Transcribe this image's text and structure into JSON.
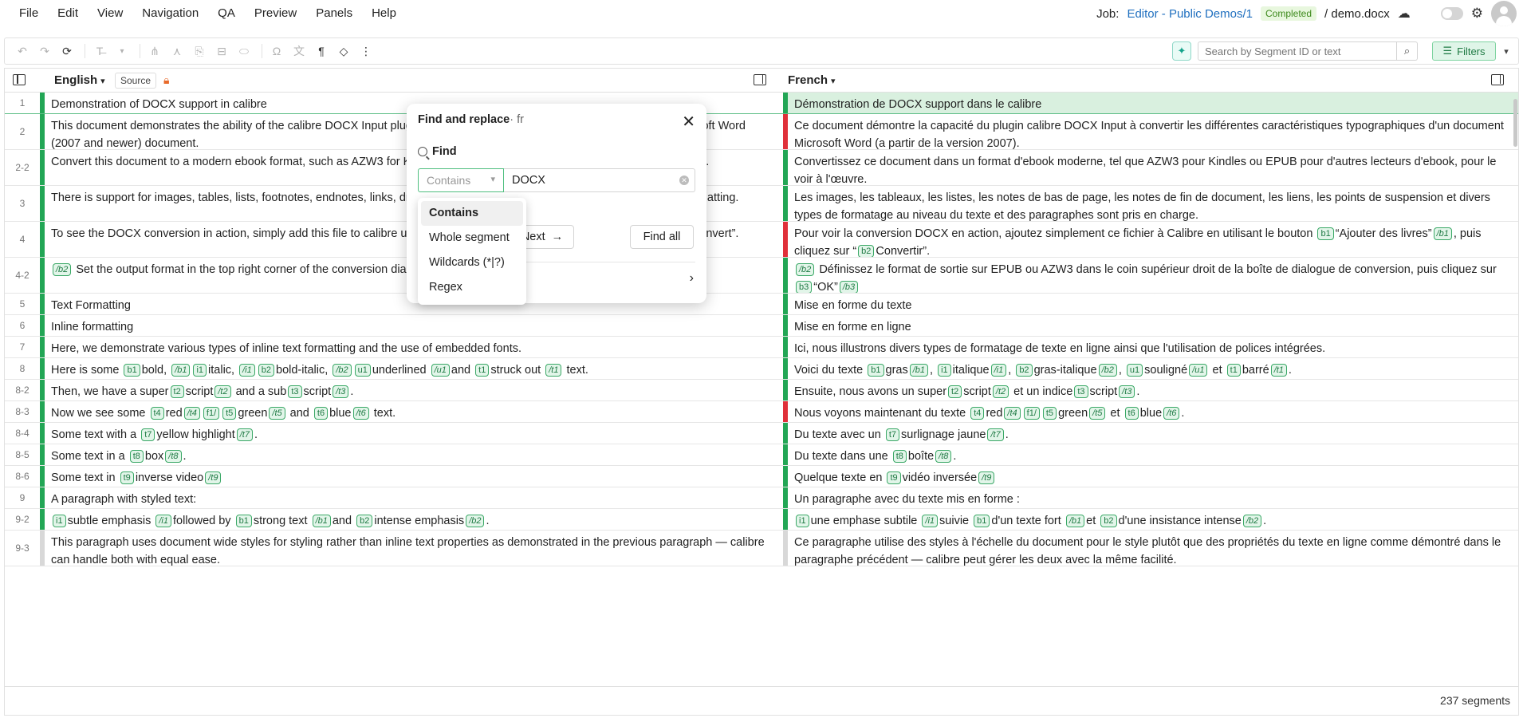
{
  "menu": [
    "File",
    "Edit",
    "View",
    "Navigation",
    "QA",
    "Preview",
    "Panels",
    "Help"
  ],
  "job": {
    "label": "Job:",
    "link": "Editor - Public Demos/1",
    "status": "Completed",
    "file": "/ demo.docx"
  },
  "search": {
    "placeholder": "Search by Segment ID or text"
  },
  "filters_label": "Filters",
  "grid": {
    "source_lang": "English",
    "source_chip": "Source",
    "target_lang": "French"
  },
  "colors": {
    "confirmed": "#22a655",
    "unconfirmed": "#e0303a",
    "none": "#d8d8d8"
  },
  "segments": [
    {
      "id": "1",
      "status": "confirmed",
      "active": true,
      "src": "Demonstration of DOCX support in calibre",
      "tgt": "Démonstration de DOCX support dans le calibre"
    },
    {
      "id": "2",
      "status": "unconfirmed",
      "src": "This document demonstrates the ability of the calibre DOCX Input plugin to convert the various typographic features in a Microsoft Word (2007 and newer) document.",
      "tgt": "Ce document démontre la capacité du plugin calibre DOCX Input à convertir les différentes caractéristiques typographiques d'un document Microsoft Word (a partir de la version 2007)."
    },
    {
      "id": "2-2",
      "status": "confirmed",
      "src": "Convert this document to a modern ebook format, such as AZW3 for Kindles or EPUB for other ebook readers, to see it in action.",
      "tgt": "Convertissez ce document dans un format d'ebook moderne, tel que AZW3 pour Kindles ou EPUB pour d'autres lecteurs d'ebook, pour le voir à l'œuvre."
    },
    {
      "id": "3",
      "status": "confirmed",
      "src": "There is support for images, tables, lists, footnotes, endnotes, links, dropcaps and various types of text and paragraph level formatting.",
      "tgt": "Les images, les tableaux, les listes, les notes de bas de page, les notes de fin de document, les liens, les points de suspension et divers types de formatage au niveau du texte et des paragraphes sont pris en charge."
    },
    {
      "id": "4",
      "status": "unconfirmed",
      "src_html": "To see the DOCX conversion in action, simply add this file to calibre using the <b1>“Add Books”</b1> button and then click “<b2>Convert”.",
      "tgt_html": "Pour voir la conversion DOCX en action, ajoutez simplement ce fichier à Calibre en utilisant le bouton [b1]“Ajouter des livres”[/b1], puis cliquez sur “[b2]Convertir”."
    },
    {
      "id": "4-2",
      "status": "confirmed",
      "src_html": "[/b2] Set the output format in the top right corner of the conversion dialog to EPUB or AZW3 and click [b3]“OK”[/b3]",
      "tgt_html": "[/b2] Définissez le format de sortie sur EPUB ou AZW3 dans le coin supérieur droit de la boîte de dialogue de conversion, puis cliquez sur [b3]“OK”[/b3]"
    },
    {
      "id": "5",
      "status": "confirmed",
      "src": "Text Formatting",
      "tgt": "Mise en forme du texte"
    },
    {
      "id": "6",
      "status": "confirmed",
      "src": "Inline formatting",
      "tgt": "Mise en forme en ligne"
    },
    {
      "id": "7",
      "status": "confirmed",
      "src": "Here, we demonstrate various types of inline text formatting and the use of embedded fonts.",
      "tgt": "Ici, nous illustrons divers types de formatage de texte en ligne ainsi que l'utilisation de polices intégrées."
    },
    {
      "id": "8",
      "status": "confirmed",
      "src_html": "Here is some [b1]bold, [/b1][i1]italic, [/i1][b2]bold-italic, [/b2][u1]underlined [/u1]and [t1]struck out [/t1] text.",
      "tgt_html": "Voici du texte [b1]gras[/b1], [i1]italique[/i1], [b2]gras-italique[/b2], [u1]souligné[/u1] et [t1]barré[/t1]."
    },
    {
      "id": "8-2",
      "status": "confirmed",
      "src_html": "Then, we have a super[t2]script[/t2] and a sub[t3]script[/t3].",
      "tgt_html": "Ensuite, nous avons un super[t2]script[/t2] et un indice[t3]script[/t3]."
    },
    {
      "id": "8-3",
      "status": "unconfirmed",
      "src_html": "Now we see some [t4]red[/t4][f1/][t5]green[/t5] and [t6]blue[/t6] text.",
      "tgt_html": "Nous voyons maintenant du texte [t4]red[/t4][f1/][t5]green[/t5] et [t6]blue[/t6]."
    },
    {
      "id": "8-4",
      "status": "confirmed",
      "src_html": "Some text with a [t7]yellow highlight[/t7].",
      "tgt_html": "Du texte avec un [t7]surlignage jaune[/t7]."
    },
    {
      "id": "8-5",
      "status": "confirmed",
      "src_html": "Some text in a [t8]box[/t8].",
      "tgt_html": "Du texte dans une [t8]boîte[/t8]."
    },
    {
      "id": "8-6",
      "status": "confirmed",
      "src_html": "Some text in [t9]inverse video[/t9]",
      "tgt_html": "Quelque texte en [t9]vidéo inversée[/t9]"
    },
    {
      "id": "9",
      "status": "confirmed",
      "src": "A paragraph with styled text:",
      "tgt": "Un paragraphe avec du texte mis en forme :"
    },
    {
      "id": "9-2",
      "status": "confirmed",
      "src_html": "[i1]subtle emphasis  [/i1]followed by [b1]strong text [/b1]and [b2]intense emphasis[/b2].",
      "tgt_html": "[i1]une emphase subtile  [/i1]suivie [b1]d'un texte fort [/b1]et [b2]d'une insistance intense[/b2]."
    },
    {
      "id": "9-3",
      "status": "none",
      "src": "This paragraph uses document wide styles for styling rather than inline text properties as demonstrated in the previous paragraph — calibre can handle both with equal ease.",
      "tgt": "Ce paragraphe utilise des styles à l'échelle du document pour le style plutôt que des propriétés du texte en ligne comme démontré dans le paragraphe précédent — calibre peut gérer les deux avec la même facilité."
    }
  ],
  "footer": {
    "segment_count": "237 segments"
  },
  "find_dialog": {
    "title": "Find and replace",
    "lang": "· fr",
    "find_label": "Find",
    "mode": "Contains",
    "query": "DOCX",
    "next_label": "Next",
    "find_all_label": "Find all",
    "mode_options": [
      "Contains",
      "Whole segment",
      "Wildcards (*|?)",
      "Regex"
    ]
  }
}
